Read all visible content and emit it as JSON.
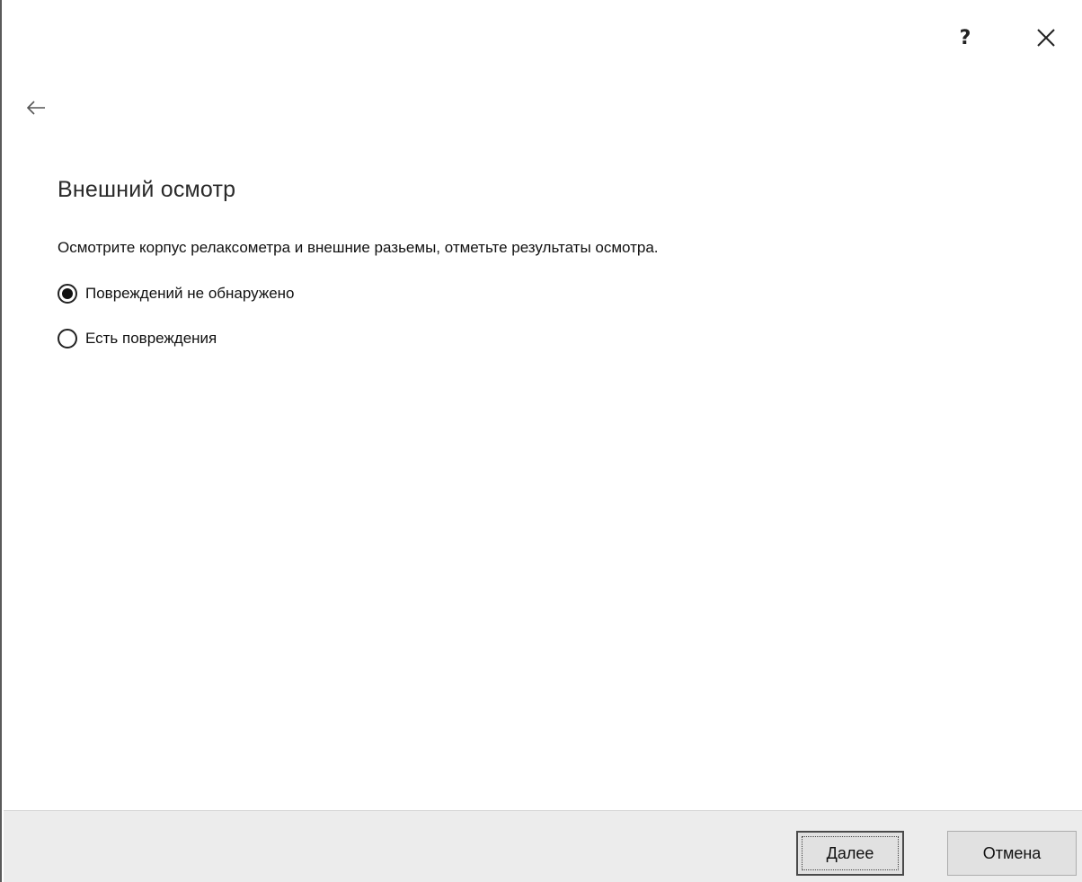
{
  "window": {
    "help_label": "?",
    "icons": {
      "help": "question-mark",
      "close": "close-x",
      "back": "arrow-left"
    }
  },
  "page": {
    "title": "Внешний осмотр",
    "instructions": "Осмотрите корпус релаксометра и внешние разьемы, отметьте результаты осмотра."
  },
  "options": {
    "selected_index": 0,
    "items": [
      {
        "label": "Повреждений не обнаружено",
        "checked": true
      },
      {
        "label": "Есть повреждения",
        "checked": false
      }
    ]
  },
  "footer": {
    "next_label": "Далее",
    "cancel_label": "Отмена"
  }
}
